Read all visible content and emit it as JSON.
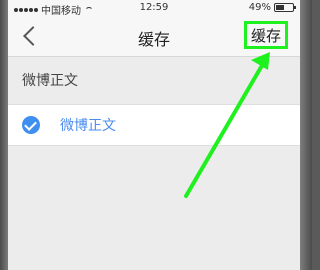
{
  "status_bar": {
    "carrier": "中国移动",
    "time": "12:59",
    "battery": "49%",
    "battery_level": 0.49
  },
  "nav": {
    "back_icon": "chevron-left-icon",
    "title": "缓存",
    "save_label": "缓存"
  },
  "section": {
    "header": "微博正文"
  },
  "list": {
    "items": [
      {
        "label": "微博正文",
        "checked": true,
        "icon": "check-circle-icon"
      }
    ]
  },
  "colors": {
    "highlight_green": "#1ef11e",
    "accent_blue": "#3f8ff1",
    "label_blue": "#4a8cf0"
  }
}
